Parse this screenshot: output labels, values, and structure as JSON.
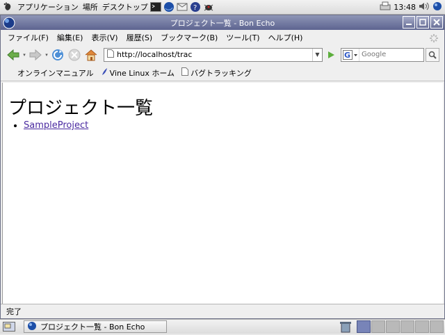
{
  "top_panel": {
    "applications": "アプリケーション",
    "places": "場所",
    "desktop": "デスクトップ",
    "clock": "13:48"
  },
  "window": {
    "title": "プロジェクト一覧 - Bon Echo"
  },
  "menubar": {
    "items": [
      "ファイル(F)",
      "編集(E)",
      "表示(V)",
      "履歴(S)",
      "ブックマーク(B)",
      "ツール(T)",
      "ヘルプ(H)"
    ]
  },
  "navbar": {
    "url": "http://localhost/trac",
    "search_placeholder": "Google"
  },
  "bookmarks": [
    "オンラインマニュアル",
    "Vine Linux ホーム",
    "バグトラッキング"
  ],
  "page": {
    "heading": "プロジェクト一覧",
    "projects": [
      "SampleProject"
    ]
  },
  "status": {
    "text": "完了"
  },
  "taskbar": {
    "task_label": "プロジェクト一覧 - Bon Echo"
  },
  "colors": {
    "titlebar": "#6a7199",
    "link": "#4a2aa0",
    "workspace_active": "#7884b8"
  }
}
